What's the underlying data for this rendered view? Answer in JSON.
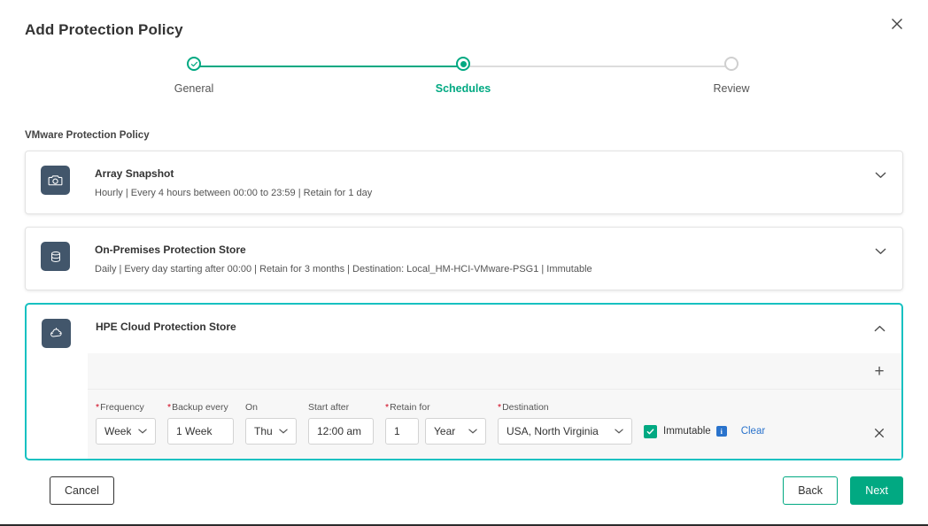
{
  "dialog": {
    "title": "Add Protection Policy",
    "close_icon": "close-icon"
  },
  "stepper": {
    "steps": [
      {
        "label": "General",
        "state": "completed",
        "icon": "check-icon"
      },
      {
        "label": "Schedules",
        "state": "current",
        "icon": "filled-dot-icon"
      },
      {
        "label": "Review",
        "state": "pending",
        "icon": "empty-dot-icon"
      }
    ]
  },
  "section": {
    "title": "VMware Protection Policy"
  },
  "cards": [
    {
      "name": "Array Snapshot",
      "summary": "Hourly | Every 4 hours between 00:00 to 23:59 | Retain for 1 day",
      "icon": "camera-icon",
      "expanded": false,
      "chevron": "chevron-down-icon"
    },
    {
      "name": "On-Premises Protection Store",
      "summary": "Daily | Every day starting after 00:00 | Retain for 3 months | Destination: Local_HM-HCI-VMware-PSG1 | Immutable",
      "icon": "database-icon",
      "expanded": false,
      "chevron": "chevron-down-icon"
    },
    {
      "name": "HPE Cloud Protection Store",
      "summary": "",
      "icon": "cloud-icon",
      "expanded": true,
      "chevron": "chevron-up-icon"
    }
  ],
  "schedule_form": {
    "add_label": "+",
    "fields": {
      "frequency": {
        "label": "Frequency",
        "required": true,
        "value": "Weekly",
        "type": "select"
      },
      "backup_every": {
        "label": "Backup every",
        "required": true,
        "value": "1 Week",
        "type": "input"
      },
      "on": {
        "label": "On",
        "required": false,
        "value": "Thu",
        "type": "select"
      },
      "start_after": {
        "label": "Start after",
        "required": false,
        "value": "12:00 am",
        "type": "input"
      },
      "retain_for": {
        "label": "Retain for",
        "required": true,
        "value": "1",
        "type": "input"
      },
      "retain_unit": {
        "label": "",
        "required": false,
        "value": "Year",
        "type": "select"
      },
      "destination": {
        "label": "Destination",
        "required": true,
        "value": "USA, North Virginia",
        "type": "select"
      }
    },
    "immutable": {
      "label": "Immutable",
      "checked": true,
      "info_icon": "info-icon",
      "info_glyph": "i"
    },
    "clear_label": "Clear",
    "remove_icon": "close-icon"
  },
  "footer": {
    "cancel_label": "Cancel",
    "back_label": "Back",
    "next_label": "Next"
  },
  "colors": {
    "accent_green": "#01a982",
    "expanded_border": "#17c1c1",
    "icon_tile": "#42566b",
    "link_blue": "#2a73cc",
    "required_red": "#d0021b"
  }
}
